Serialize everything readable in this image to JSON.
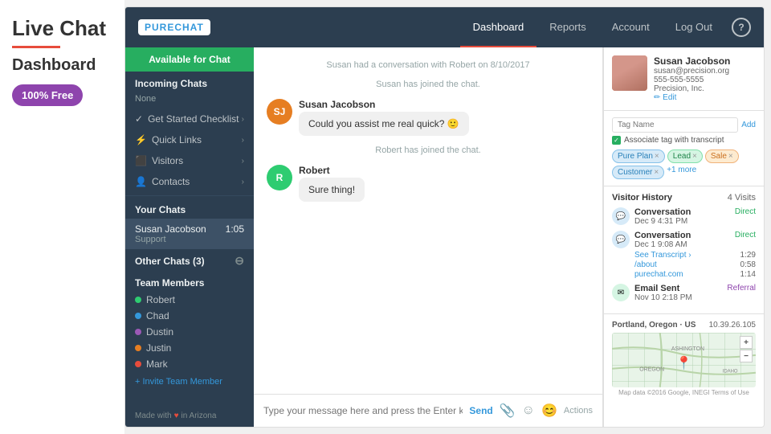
{
  "branding": {
    "title": "Live Chat",
    "subtitle": "Dashboard",
    "badge": "100% Free",
    "underline_color": "#e74c3c",
    "badge_color": "#8e44ad"
  },
  "top_nav": {
    "logo_text": "PURE",
    "logo_accent": "CHAT",
    "links": [
      {
        "label": "Dashboard",
        "active": true
      },
      {
        "label": "Reports",
        "active": false
      },
      {
        "label": "Account",
        "active": false
      },
      {
        "label": "Log Out",
        "active": false
      }
    ],
    "help_label": "?"
  },
  "sidebar": {
    "available_label": "Available for Chat",
    "incoming_chats_title": "Incoming Chats",
    "incoming_none": "None",
    "nav_items": [
      {
        "icon": "✓",
        "label": "Get Started Checklist"
      },
      {
        "icon": "⚡",
        "label": "Quick Links"
      },
      {
        "icon": "👥",
        "label": "Visitors"
      },
      {
        "icon": "👤",
        "label": "Contacts"
      }
    ],
    "your_chats_title": "Your Chats",
    "chat_item": {
      "name": "Susan Jacobson",
      "sub": "Support",
      "time": "1:05"
    },
    "other_chats_title": "Other Chats (3)",
    "team_members_title": "Team Members",
    "team": [
      {
        "name": "Robert",
        "color": "#2ecc71"
      },
      {
        "name": "Chad",
        "color": "#3498db"
      },
      {
        "name": "Dustin",
        "color": "#9b59b6"
      },
      {
        "name": "Justin",
        "color": "#e67e22"
      },
      {
        "name": "Mark",
        "color": "#e74c3c"
      }
    ],
    "invite_label": "+ Invite Team Member",
    "footer_made": "Made with",
    "footer_loc": "in Arizona"
  },
  "chat": {
    "system_msgs": [
      "Susan had a conversation with Robert on 8/10/2017",
      "Susan has joined the chat.",
      "Robert has joined the chat."
    ],
    "messages": [
      {
        "sender": "Susan Jacobson",
        "text": "Could you assist me real quick? 🙂",
        "avatar_initials": "SJ",
        "avatar_color": "#e67e22"
      },
      {
        "sender": "Robert",
        "text": "Sure thing!",
        "avatar_initials": "R",
        "avatar_color": "#2ecc71"
      }
    ],
    "input_placeholder": "Type your message here and press the Enter key to send.",
    "send_label": "Send",
    "actions_label": "Actions"
  },
  "visitor": {
    "name": "Susan Jacobson",
    "email": "susan@precision.org",
    "phone": "555-555-5555",
    "company": "Precision, Inc.",
    "edit_label": "✏ Edit",
    "tag_placeholder": "Tag Name",
    "tag_add_label": "Add",
    "associate_label": "Associate tag with transcript",
    "tags": [
      {
        "label": "Pure Plan",
        "type": "blue"
      },
      {
        "label": "Lead",
        "type": "green"
      },
      {
        "label": "Sale",
        "type": "orange"
      },
      {
        "label": "Customer",
        "type": "blue"
      },
      {
        "label": "+1 more",
        "type": "more"
      }
    ],
    "history_title": "Visitor History",
    "history_visits": "4 Visits",
    "history_items": [
      {
        "type": "Conversation",
        "date": "Dec 9 4:31 PM",
        "source": "Direct",
        "source_type": "direct",
        "icon_type": "chat"
      },
      {
        "type": "Conversation",
        "date": "Dec 1 9:08 AM",
        "source": "Direct",
        "source_type": "direct",
        "icon_type": "chat",
        "sub_links": [
          "See Transcript ›",
          "/about",
          "purechat.com"
        ],
        "times": [
          "1:29",
          "0:58",
          "1:14"
        ]
      },
      {
        "type": "Email Sent",
        "date": "Nov 10 2:18 PM",
        "source": "Referral",
        "source_type": "referral",
        "icon_type": "email"
      }
    ],
    "map_location": "Portland, Oregon · US",
    "map_ip": "10.39.26.105",
    "map_footer": "Map data ©2016 Google, INEGI   Terms of Use"
  }
}
